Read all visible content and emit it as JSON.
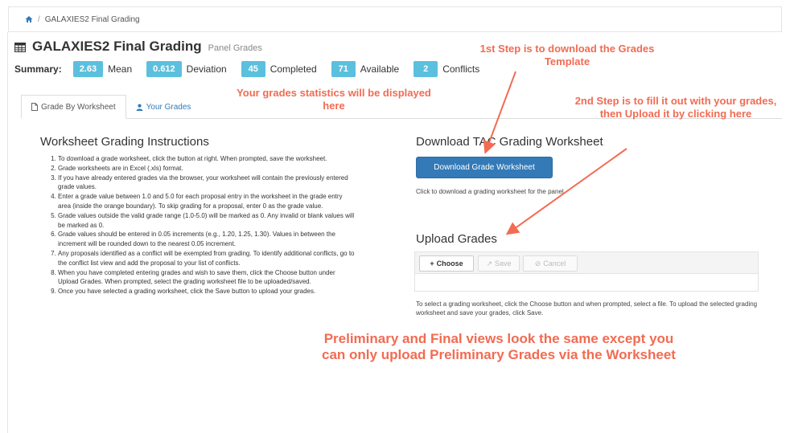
{
  "breadcrumb": {
    "home_icon": "home-icon",
    "separator": "/",
    "current": "GALAXIES2 Final Grading"
  },
  "header": {
    "title_icon": "table-icon",
    "title": "GALAXIES2 Final Grading",
    "subtitle": "Panel Grades"
  },
  "summary": {
    "label": "Summary:",
    "badge_color": "#5bc0de",
    "stats": [
      {
        "value": "2.63",
        "label": "Mean"
      },
      {
        "value": "0.612",
        "label": "Deviation"
      },
      {
        "value": "45",
        "label": "Completed"
      },
      {
        "value": "71",
        "label": "Available"
      },
      {
        "value": "2",
        "label": "Conflicts"
      }
    ]
  },
  "tabs": [
    {
      "label": "Grade By Worksheet",
      "icon": "document-icon",
      "active": true
    },
    {
      "label": "Your Grades",
      "icon": "user-icon",
      "active": false
    }
  ],
  "instructions": {
    "heading": "Worksheet Grading Instructions",
    "items": [
      "To download a grade worksheet, click the button at right. When prompted, save the worksheet.",
      "Grade worksheets are in Excel (.xls) format.",
      "If you have already entered grades via the browser, your worksheet will contain the previously entered grade values.",
      "Enter a grade value between 1.0 and 5.0 for each proposal entry in the worksheet in the grade entry area (inside the orange boundary). To skip grading for a proposal, enter 0 as the grade value.",
      "Grade values outside the valid grade range (1.0-5.0) will be marked as 0. Any invalid or blank values will be marked as 0.",
      "Grade values should be entered in 0.05 increments (e.g., 1.20, 1.25, 1.30). Values in between the increment will be rounded down to the nearest 0.05 increment.",
      "Any proposals identified as a conflict will be exempted from grading. To identify additional conflicts, go to the conflict list view and add the proposal to your list of conflicts.",
      "When you have completed entering grades and wish to save them, click the Choose button under Upload Grades. When prompted, select the grading worksheet file to be uploaded/saved.",
      "Once you have selected a grading worksheet, click the Save button to upload your grades."
    ]
  },
  "download": {
    "heading": "Download TAC Grading Worksheet",
    "button_label": "Download Grade Worksheet",
    "button_color": "#337ab7",
    "help": "Click to download a grading worksheet for the panel."
  },
  "upload": {
    "heading": "Upload Grades",
    "choose_label": "Choose",
    "save_label": "Save",
    "cancel_label": "Cancel",
    "help": "To select a grading worksheet, click the Choose button and when prompted, select a file. To upload the selected grading worksheet and save your grades, click Save."
  },
  "annotations": {
    "color": "#f26b52",
    "step1": "1st Step is to download the Grades Template",
    "step2": "2nd Step is to fill it out with your grades, then Upload it by clicking here",
    "stats_note": "Your grades statistics will be displayed here",
    "views_note": "Preliminary and Final views look the same except you can only upload Preliminary Grades via the Worksheet"
  }
}
